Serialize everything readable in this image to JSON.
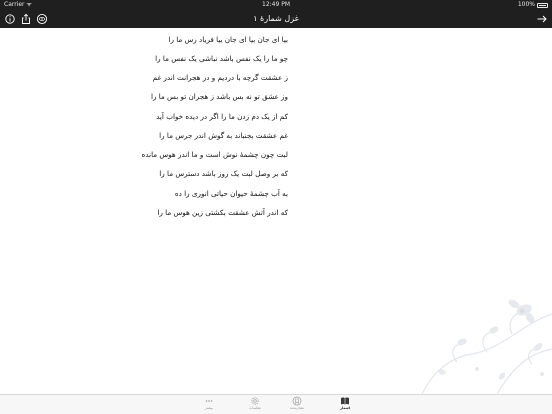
{
  "status_bar": {
    "carrier": "Carrier ᯤ",
    "time": "12:49 PM",
    "battery_pct": "100%"
  },
  "nav": {
    "title": "غزل شمارهٔ ۱"
  },
  "verses": [
    "بیا ای جان بیا ای جان بیا فریاد رس ما را",
    "چو ما را یک نفس باشد نباشی یک نفس ما را",
    "ز عشقت گرچه با دردیم و در هجرانت اندر غم",
    "وز عشق تو نه بس باشد ز هجران تو بس ما را",
    "کم از یک دم زدن ما را اگر در دیده خواب آید",
    "غم عشقت بجنباند به گوش اندر جرس ما را",
    "لبت چون چشمهٔ نوش است و ما اندر هوس مانده",
    "که بر وصل لبت یک روز باشد دسترس ما را",
    "به آب چشمهٔ حیوان حیاتی انوری را ده",
    "که اندر آتش عشقت بکشتی زین هوس ما را"
  ],
  "tabs": [
    {
      "label": "اشعار",
      "icon": "book-icon",
      "active": true
    },
    {
      "label": "نشان‌شده",
      "icon": "bookmark-icon",
      "active": false
    },
    {
      "label": "تنظیمات",
      "icon": "settings-icon",
      "active": false
    },
    {
      "label": "بیشتر",
      "icon": "more-icon",
      "active": false
    }
  ]
}
